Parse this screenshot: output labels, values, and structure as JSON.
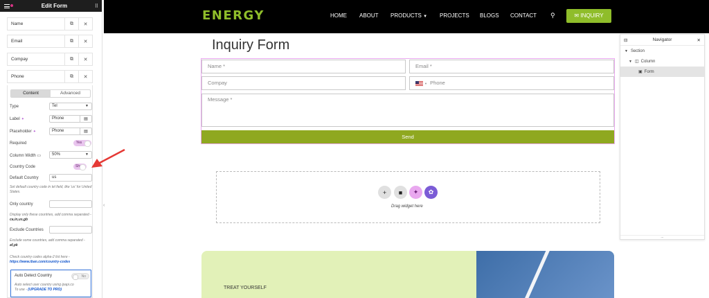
{
  "panel": {
    "title": "Edit Form",
    "fields": [
      {
        "label": "Name"
      },
      {
        "label": "Email"
      },
      {
        "label": "Compay"
      },
      {
        "label": "Phone"
      }
    ],
    "tabs": {
      "content": "Content",
      "advanced": "Advanced"
    },
    "controls": {
      "type_label": "Type",
      "type_value": "Tel",
      "label_label": "Label",
      "label_value": "Phone",
      "placeholder_label": "Placeholder",
      "placeholder_value": "Phone",
      "required_label": "Required",
      "required_value": "Yes",
      "column_width_label": "Column Width",
      "column_width_value": "50%",
      "country_code_label": "Country Code",
      "country_code_value": "Show",
      "default_country_label": "Default Country",
      "default_country_value": "us",
      "default_country_help": "Set default country code in tel field, like 'us' for United States.",
      "only_country_label": "Only country",
      "only_country_value": "",
      "only_country_help_prefix": "Display only these countries, add comma separated - ",
      "only_country_help_example": "ca,in,us,gb",
      "exclude_label": "Exclude Countries",
      "exclude_value": "",
      "exclude_help_prefix": "Exclude some countries, add comma separated - ",
      "exclude_help_example": "af,pk",
      "codes_help": "Check country codes alpha-2 list here -",
      "codes_link": "https://www.iban.com/country-codes",
      "auto_detect_label": "Auto Detect Country",
      "auto_detect_value": "No",
      "auto_detect_help": "Auto select user country using ipapi.co",
      "auto_detect_upgrade_prefix": "To use - ",
      "auto_detect_upgrade": "(UPGRADE TO PRO)"
    }
  },
  "header": {
    "logo": "ENERGY",
    "nav": [
      "HOME",
      "ABOUT",
      "PRODUCTS",
      "PROJECTS",
      "BLOGS",
      "CONTACT"
    ],
    "inquiry_button": "INQUIRY",
    "brand_color": "#8fbd2a"
  },
  "form": {
    "title": "Inquiry Form",
    "name_placeholder": "Name *",
    "email_placeholder": "Email *",
    "company_placeholder": "Compay",
    "phone_placeholder": "Phone",
    "message_placeholder": "Message *",
    "send_label": "Send"
  },
  "drop_area": {
    "text": "Drag widget here"
  },
  "banner": {
    "text": "TREAT YOURSELF"
  },
  "navigator": {
    "title": "Navigator",
    "items": [
      {
        "label": "Section"
      },
      {
        "label": "Column"
      },
      {
        "label": "Form"
      }
    ],
    "footer": "..."
  }
}
